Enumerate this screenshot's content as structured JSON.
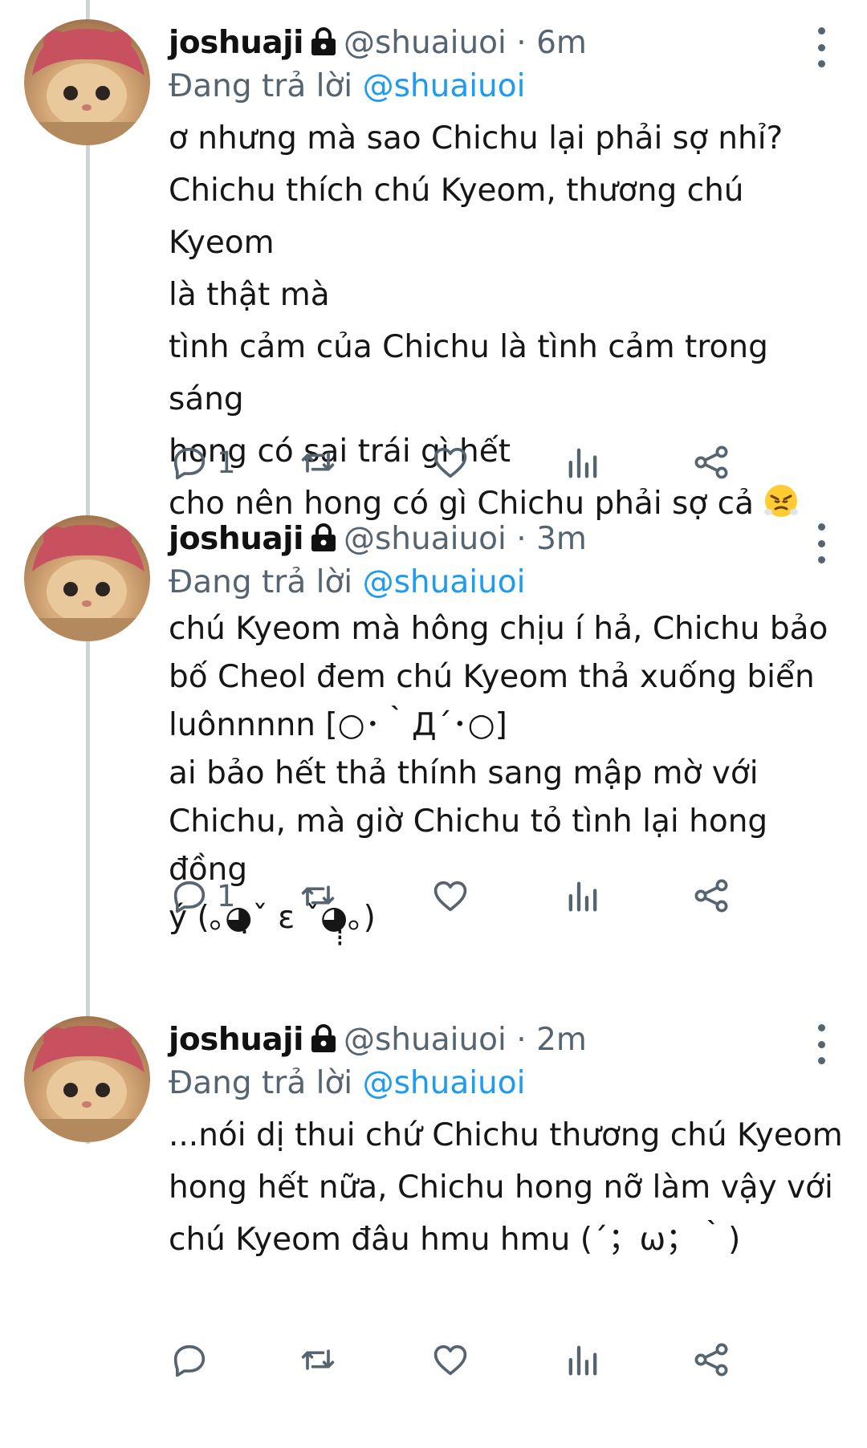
{
  "tweets": [
    {
      "name": "joshuaji",
      "handle": "@shuaiuoi",
      "separator": "·",
      "time": "6m",
      "reply_prefix": "Đang trả lời",
      "reply_mention": "@shuaiuoi",
      "text": " ơ nhưng mà sao Chichu lại phải sợ nhỉ?\nChichu thích chú Kyeom, thương chú Kyeom\nlà thật mà\ntình cảm của Chichu là tình cảm trong sáng\nhong có sai trái gì hết\ncho nên hong có gì Chichu phải sợ cả",
      "emoji": "😤",
      "reply_count": "1"
    },
    {
      "name": "joshuaji",
      "handle": "@shuaiuoi",
      "separator": "·",
      "time": "3m",
      "reply_prefix": "Đang trả lời",
      "reply_mention": "@shuaiuoi",
      "text": "chú Kyeom mà hông chịu í hả, Chichu bảo\nbố Cheol đem chú Kyeom thả xuống biển\nluônnnnn [○･｀Д´･○]\nai bảo hết thả thính sang mập mờ với\nChichu, mà giờ Chichu tỏ tình lại hong đồng\ný (｡◕̣̣̣ˇ ε ˇ◕̣̣̣｡)",
      "emoji": "",
      "reply_count": "1"
    },
    {
      "name": "joshuaji",
      "handle": "@shuaiuoi",
      "separator": "·",
      "time": "2m",
      "reply_prefix": "Đang trả lời",
      "reply_mention": "@shuaiuoi",
      "text": "...nói dị thui chứ Chichu thương chú Kyeom\nhong hết nữa, Chichu hong nỡ làm vậy với\nchú Kyeom đâu hmu hmu (´；ω；｀)",
      "emoji": "",
      "reply_count": ""
    }
  ],
  "icons": {
    "reply": "reply-icon",
    "retweet": "retweet-icon",
    "like": "heart-icon",
    "views": "views-icon",
    "share": "share-icon",
    "lock": "lock-icon",
    "more": "more-vertical-icon"
  },
  "colors": {
    "link": "#1d9bf0",
    "muted": "#566470",
    "thread_line": "#cfd3d6"
  }
}
